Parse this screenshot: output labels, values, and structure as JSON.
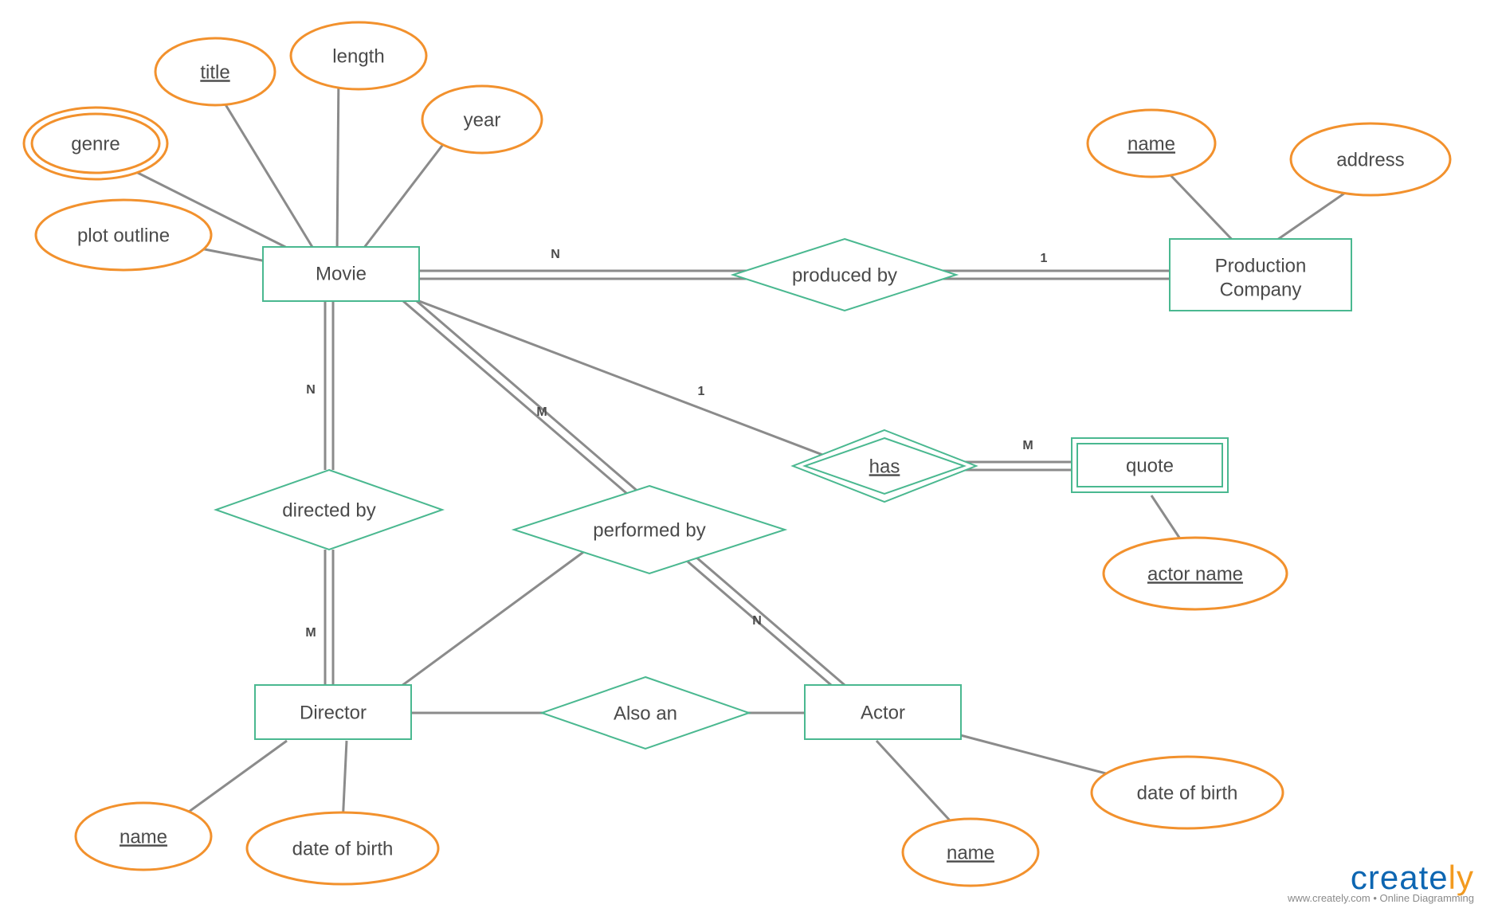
{
  "entities": {
    "movie": "Movie",
    "production_company_1": "Production",
    "production_company_2": "Company",
    "director": "Director",
    "actor": "Actor",
    "quote": "quote"
  },
  "relationships": {
    "produced_by": "produced by",
    "directed_by": "directed by",
    "performed_by": "performed by",
    "also_an": "Also an",
    "has": "has"
  },
  "attributes": {
    "movie_title": "title",
    "movie_length": "length",
    "movie_year": "year",
    "movie_genre": "genre",
    "movie_plot": "plot outline",
    "pc_name": "name",
    "pc_address": "address",
    "director_name": "name",
    "director_dob": "date of birth",
    "actor_name": "name",
    "actor_dob": "date of birth",
    "quote_actor_name": "actor name"
  },
  "cardinalities": {
    "movie_produced": "N",
    "produced_company": "1",
    "movie_directed": "N",
    "directed_director": "M",
    "movie_performed": "M",
    "performed_actor": "N",
    "movie_has": "1",
    "has_quote": "M"
  },
  "branding": {
    "name_blue": "create",
    "name_orange": "ly",
    "subtitle": "www.creately.com • Online Diagramming"
  }
}
